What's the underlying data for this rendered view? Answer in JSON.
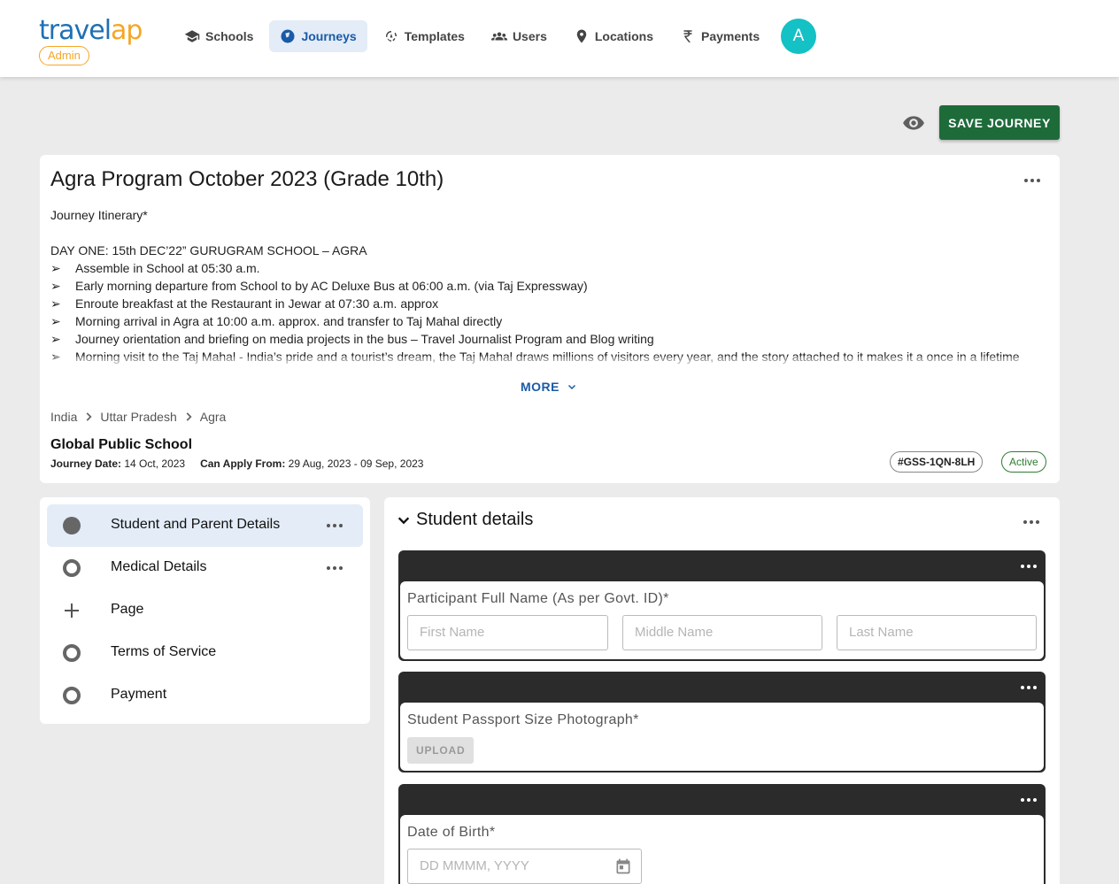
{
  "brand": {
    "logo_part1": "travel",
    "logo_part2": "ap",
    "badge": "Admin"
  },
  "nav": {
    "items": [
      {
        "label": "Schools",
        "icon": "school-icon"
      },
      {
        "label": "Journeys",
        "icon": "compass-icon",
        "active": true
      },
      {
        "label": "Templates",
        "icon": "templates-icon"
      },
      {
        "label": "Users",
        "icon": "users-icon"
      },
      {
        "label": "Locations",
        "icon": "location-pin-icon"
      },
      {
        "label": "Payments",
        "icon": "rupee-icon"
      }
    ],
    "avatar_initial": "A"
  },
  "actions": {
    "save_label": "SAVE JOURNEY",
    "preview_icon": "eye-icon"
  },
  "journey": {
    "title": "Agra Program October 2023 (Grade 10th)",
    "itinerary_heading": "Journey Itinerary*",
    "day_one": "DAY ONE: 15th DEC’22” GURUGRAM SCHOOL – AGRA",
    "bullet": "➢",
    "bullets": [
      "Assemble in School at 05:30 a.m.",
      "Early morning departure from School to by AC Deluxe Bus at 06:00 a.m. (via Taj Expressway)",
      "Enroute breakfast at the Restaurant in Jewar at 07:30 a.m. approx",
      "Morning arrival in Agra at 10:00 a.m. approx. and transfer to Taj Mahal directly",
      "Journey orientation and briefing on media projects in the bus – Travel Journalist Program and Blog writing",
      "Morning visit to the Taj Mahal  - India’s pride and a tourist’s dream, the Taj Mahal draws millions of visitors every year, and the story attached to it makes it a once in a lifetime"
    ],
    "more_label": "MORE",
    "breadcrumb": [
      "India",
      "Uttar Pradesh",
      "Agra"
    ],
    "school": "Global Public School",
    "journey_date_label": "Journey Date:",
    "journey_date": "14 Oct, 2023",
    "apply_label": "Can Apply From:",
    "apply_range": "29 Aug, 2023 - 09 Sep, 2023",
    "code": "#GSS-1QN-8LH",
    "status": "Active",
    "status_color": "#2e7d32"
  },
  "steps": [
    {
      "label": "Student and Parent Details",
      "state": "current"
    },
    {
      "label": "Medical Details",
      "state": "pending"
    },
    {
      "label": "Page",
      "state": "add"
    },
    {
      "label": "Terms of Service",
      "state": "pending"
    },
    {
      "label": "Payment",
      "state": "pending"
    }
  ],
  "form": {
    "section_title": "Student details",
    "fields": {
      "name": {
        "label": "Participant Full Name (As per Govt. ID)*",
        "first_placeholder": "First Name",
        "middle_placeholder": "Middle Name",
        "last_placeholder": "Last Name"
      },
      "photo": {
        "label": "Student Passport Size Photograph*",
        "upload_label": "UPLOAD"
      },
      "dob": {
        "label": "Date of Birth*",
        "placeholder": "DD MMMM, YYYY"
      }
    }
  },
  "colors": {
    "accent": "#1a5aa6",
    "save": "#1e6b3a",
    "avatar": "#14c1c4",
    "logo_blue": "#1f6fb5",
    "logo_orange": "#f5a623"
  }
}
